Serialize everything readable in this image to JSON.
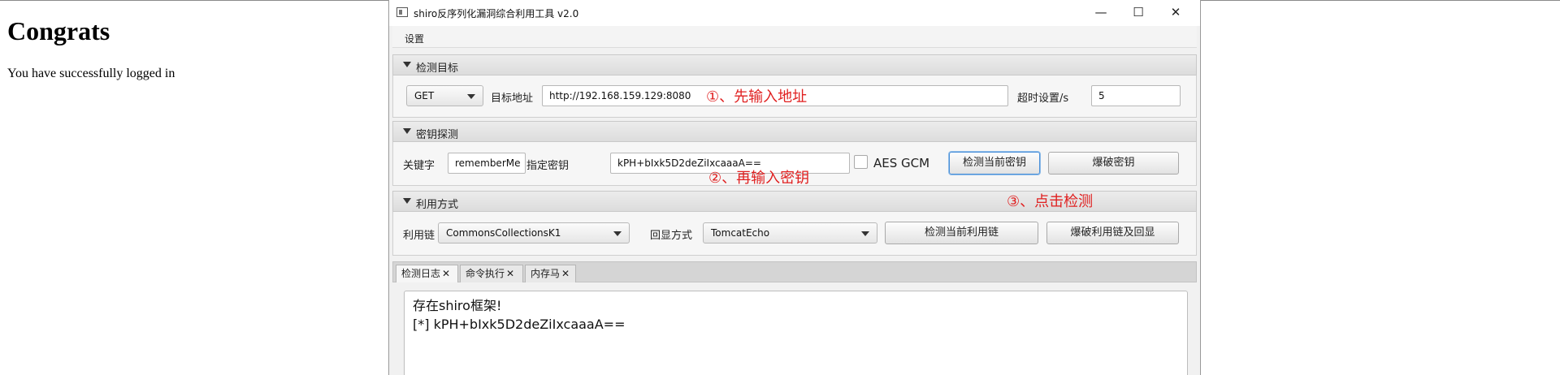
{
  "page": {
    "heading": "Congrats",
    "message": "You have successfully logged in"
  },
  "window": {
    "title": "shiro反序列化漏洞综合利用工具 v2.0",
    "controls": {
      "minimize": "—",
      "maximize": "☐",
      "close": "✕"
    },
    "menu": [
      "设置"
    ]
  },
  "target_section": {
    "title": "检测目标",
    "method": "GET",
    "url_label": "目标地址",
    "url_value": "http://192.168.159.129:8080",
    "timeout_label": "超时设置/s",
    "timeout_value": "5"
  },
  "key_section": {
    "title": "密钥探测",
    "keyword_label": "关键字",
    "keyword_value": "rememberMe",
    "key_label": "指定密钥",
    "key_value": "kPH+bIxk5D2deZiIxcaaaA==",
    "aes_gcm_label": "AES GCM",
    "aes_gcm_checked": false,
    "detect_key_button": "检测当前密钥",
    "brute_key_button": "爆破密钥"
  },
  "exploit_section": {
    "title": "利用方式",
    "chain_label": "利用链",
    "chain_value": "CommonsCollectionsK1",
    "echo_label": "回显方式",
    "echo_value": "TomcatEcho",
    "detect_chain_button": "检测当前利用链",
    "brute_chain_button": "爆破利用链及回显"
  },
  "annotations": {
    "step1": "①、先输入地址",
    "step2": "②、再输入密钥",
    "step3": "③、点击检测",
    "color": "#e02020"
  },
  "tabs": [
    {
      "label": "检测日志",
      "close": "✕",
      "active": true
    },
    {
      "label": "命令执行",
      "close": "✕",
      "active": false
    },
    {
      "label": "内存马",
      "close": "✕",
      "active": false
    }
  ],
  "log": {
    "lines": [
      "存在shiro框架!",
      "[*] kPH+bIxk5D2deZiIxcaaaA=="
    ]
  }
}
